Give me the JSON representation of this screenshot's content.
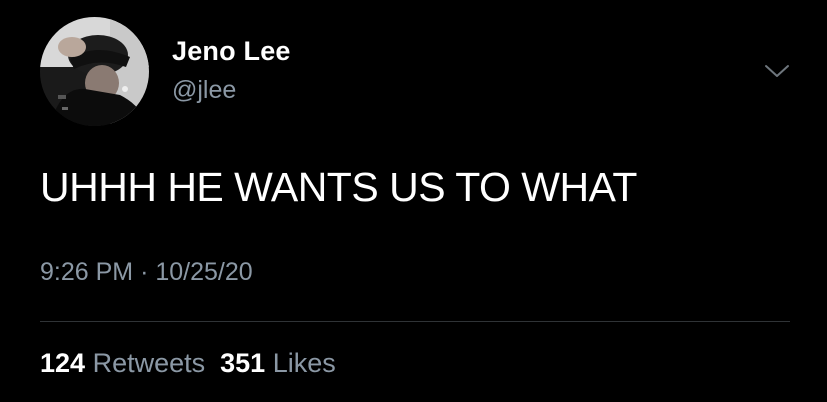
{
  "tweet": {
    "author": {
      "name": "Jeno Lee",
      "handle": "@jlee"
    },
    "text": "UHHH HE WANTS US TO WHAT",
    "time": "9:26 PM",
    "separator": "·",
    "date": "10/25/20",
    "retweets": {
      "count": "124",
      "label": "Retweets"
    },
    "likes": {
      "count": "351",
      "label": "Likes"
    },
    "menu_icon": "chevron-down-icon",
    "colors": {
      "background": "#000000",
      "text": "#ffffff",
      "secondary": "#8b98a5",
      "divider": "#2f3336"
    }
  }
}
